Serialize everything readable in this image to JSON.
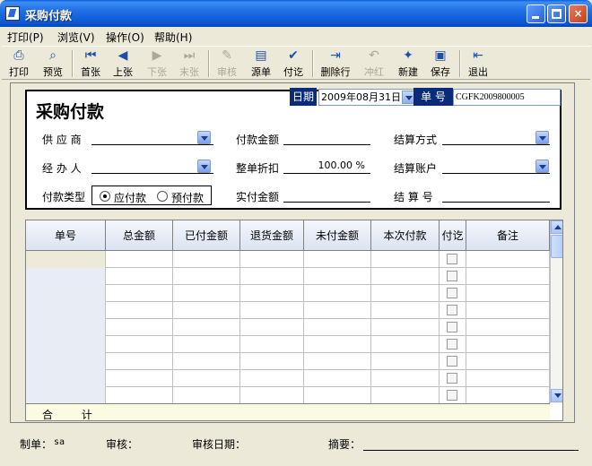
{
  "window": {
    "title": "采购付款",
    "min_label": "_",
    "max_label": "□",
    "close_label": "×"
  },
  "menu": [
    "打印(P)",
    "浏览(V)",
    "操作(O)",
    "帮助(H)"
  ],
  "toolbar": [
    {
      "label": "打印",
      "icon": "printer-icon",
      "enabled": true
    },
    {
      "label": "预览",
      "icon": "preview-icon",
      "enabled": true
    },
    {
      "label": "首张",
      "icon": "first-record-icon",
      "enabled": true
    },
    {
      "label": "上张",
      "icon": "previous-record-icon",
      "enabled": true
    },
    {
      "label": "下张",
      "icon": "next-record-icon",
      "enabled": false
    },
    {
      "label": "末张",
      "icon": "last-record-icon",
      "enabled": false
    },
    {
      "label": "审核",
      "icon": "audit-icon",
      "enabled": false
    },
    {
      "label": "源单",
      "icon": "source-document-icon",
      "enabled": true
    },
    {
      "label": "付讫",
      "icon": "paid-icon",
      "enabled": true
    },
    {
      "label": "删除行",
      "icon": "delete-row-icon",
      "enabled": true
    },
    {
      "label": "冲红",
      "icon": "reverse-icon",
      "enabled": false
    },
    {
      "label": "新建",
      "icon": "new-icon",
      "enabled": true
    },
    {
      "label": "保存",
      "icon": "save-icon",
      "enabled": true
    },
    {
      "label": "退出",
      "icon": "exit-icon",
      "enabled": true
    }
  ],
  "form": {
    "title": "采购付款",
    "date_label": "日期",
    "date_value": "2009年08月31日",
    "number_label": "单 号",
    "number_value": "CGFK2009800005",
    "supplier_label": "供 应 商",
    "handler_label": "经 办 人",
    "payment_type_label": "付款类型",
    "payment_type_options": [
      "应付款",
      "预付款"
    ],
    "payment_type_selected": "应付款",
    "payment_amount_label": "付款金额",
    "discount_label": "整单折扣",
    "discount_value": "100.00 %",
    "actual_amount_label": "实付金额",
    "settle_method_label": "结算方式",
    "settle_account_label": "结算账户",
    "settle_no_label": "结 算 号"
  },
  "grid": {
    "columns": [
      "单号",
      "总金额",
      "已付金额",
      "退货金额",
      "未付金额",
      "本次付款",
      "付讫",
      "备注"
    ],
    "row_count": 9,
    "footer_label": "合 计"
  },
  "status": {
    "maker_label": "制单：",
    "maker_value": "sa",
    "auditor_label": "审核：",
    "audit_date_label": "审核日期：",
    "summary_label": "摘要："
  }
}
